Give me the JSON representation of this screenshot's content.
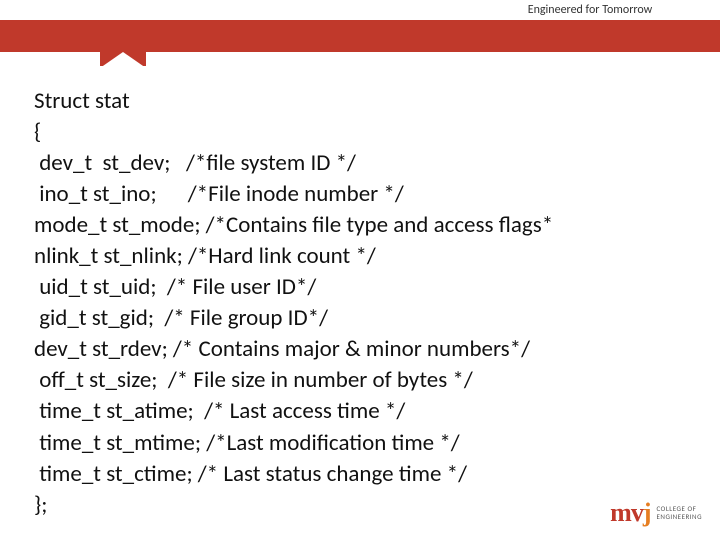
{
  "header": {
    "tagline": "Engineered for Tomorrow"
  },
  "code": {
    "lines": [
      "Struct stat",
      "{",
      " dev_t  st_dev;   /*file system ID */",
      " ino_t st_ino;      /*File inode number */",
      "mode_t st_mode; /*Contains file type and access flags*",
      "nlink_t st_nlink; /*Hard link count */",
      " uid_t st_uid;  /* File user ID*/",
      " gid_t st_gid;  /* File group ID*/",
      "dev_t st_rdev; /* Contains major & minor numbers*/",
      " off_t st_size;  /* File size in number of bytes */",
      " time_t st_atime;  /* Last access time */",
      " time_t st_mtime; /*Last modification time */",
      " time_t st_ctime; /* Last status change time */",
      "};"
    ]
  },
  "logo": {
    "brand_m": "m",
    "brand_v": "v",
    "brand_j": "j",
    "sub1": "COLLEGE OF",
    "sub2": "ENGINEERING"
  }
}
